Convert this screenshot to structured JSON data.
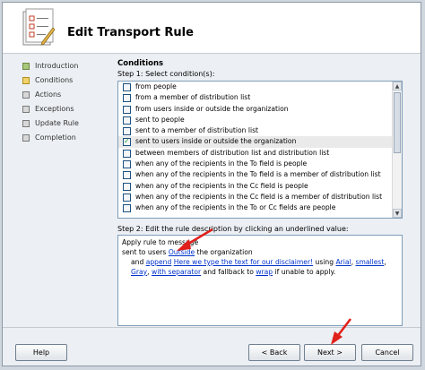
{
  "wizard": {
    "title": "Edit Transport Rule",
    "icon": "wizard-checklist-icon"
  },
  "nav": [
    {
      "label": "Introduction",
      "state": "done"
    },
    {
      "label": "Conditions",
      "state": "current"
    },
    {
      "label": "Actions",
      "state": "pending"
    },
    {
      "label": "Exceptions",
      "state": "pending"
    },
    {
      "label": "Update Rule",
      "state": "pending"
    },
    {
      "label": "Completion",
      "state": "pending"
    }
  ],
  "conditions": {
    "heading": "Conditions",
    "step1_label": "Step 1: Select condition(s):",
    "items": [
      {
        "label": "from people",
        "checked": false
      },
      {
        "label": "from a member of distribution list",
        "checked": false
      },
      {
        "label": "from users inside or outside the organization",
        "checked": false
      },
      {
        "label": "sent to people",
        "checked": false
      },
      {
        "label": "sent to a member of distribution list",
        "checked": false
      },
      {
        "label": "sent to users inside or outside the organization",
        "checked": true
      },
      {
        "label": "between members of distribution list and distribution list",
        "checked": false
      },
      {
        "label": "when any of the recipients in the To field is people",
        "checked": false
      },
      {
        "label": "when any of the recipients in the To field is a member of distribution list",
        "checked": false
      },
      {
        "label": "when any of the recipients in the Cc field is people",
        "checked": false
      },
      {
        "label": "when any of the recipients in the Cc field is a member of distribution list",
        "checked": false
      },
      {
        "label": "when any of the recipients in the To or Cc fields are people",
        "checked": false
      }
    ],
    "step2_label": "Step 2: Edit the rule description by clicking an underlined value:",
    "description": {
      "line1": "Apply rule to message",
      "line2_prefix": "sent to users ",
      "line2_link": "Outside",
      "line2_suffix": " the organization",
      "line3_and": "and ",
      "line3_append": "append",
      "line3_space1": " ",
      "line3_text_link": "Here we type the text for our disclaimer!",
      "line3_using": " using ",
      "line3_font": "Arial",
      "line3_comma1": ", ",
      "line3_size": "smallest",
      "line3_comma2": ",",
      "line3_color": "Gray",
      "line3_comma3": ", ",
      "line3_sep": "with separator",
      "line3_fallback": " and fallback to ",
      "line3_wrap": "wrap",
      "line3_end": " if unable to apply."
    }
  },
  "buttons": {
    "help": "Help",
    "back": "< Back",
    "next": "Next >",
    "cancel": "Cancel"
  },
  "colors": {
    "link": "#0033cc",
    "arrow": "#e0201b",
    "check": "#21a121"
  }
}
